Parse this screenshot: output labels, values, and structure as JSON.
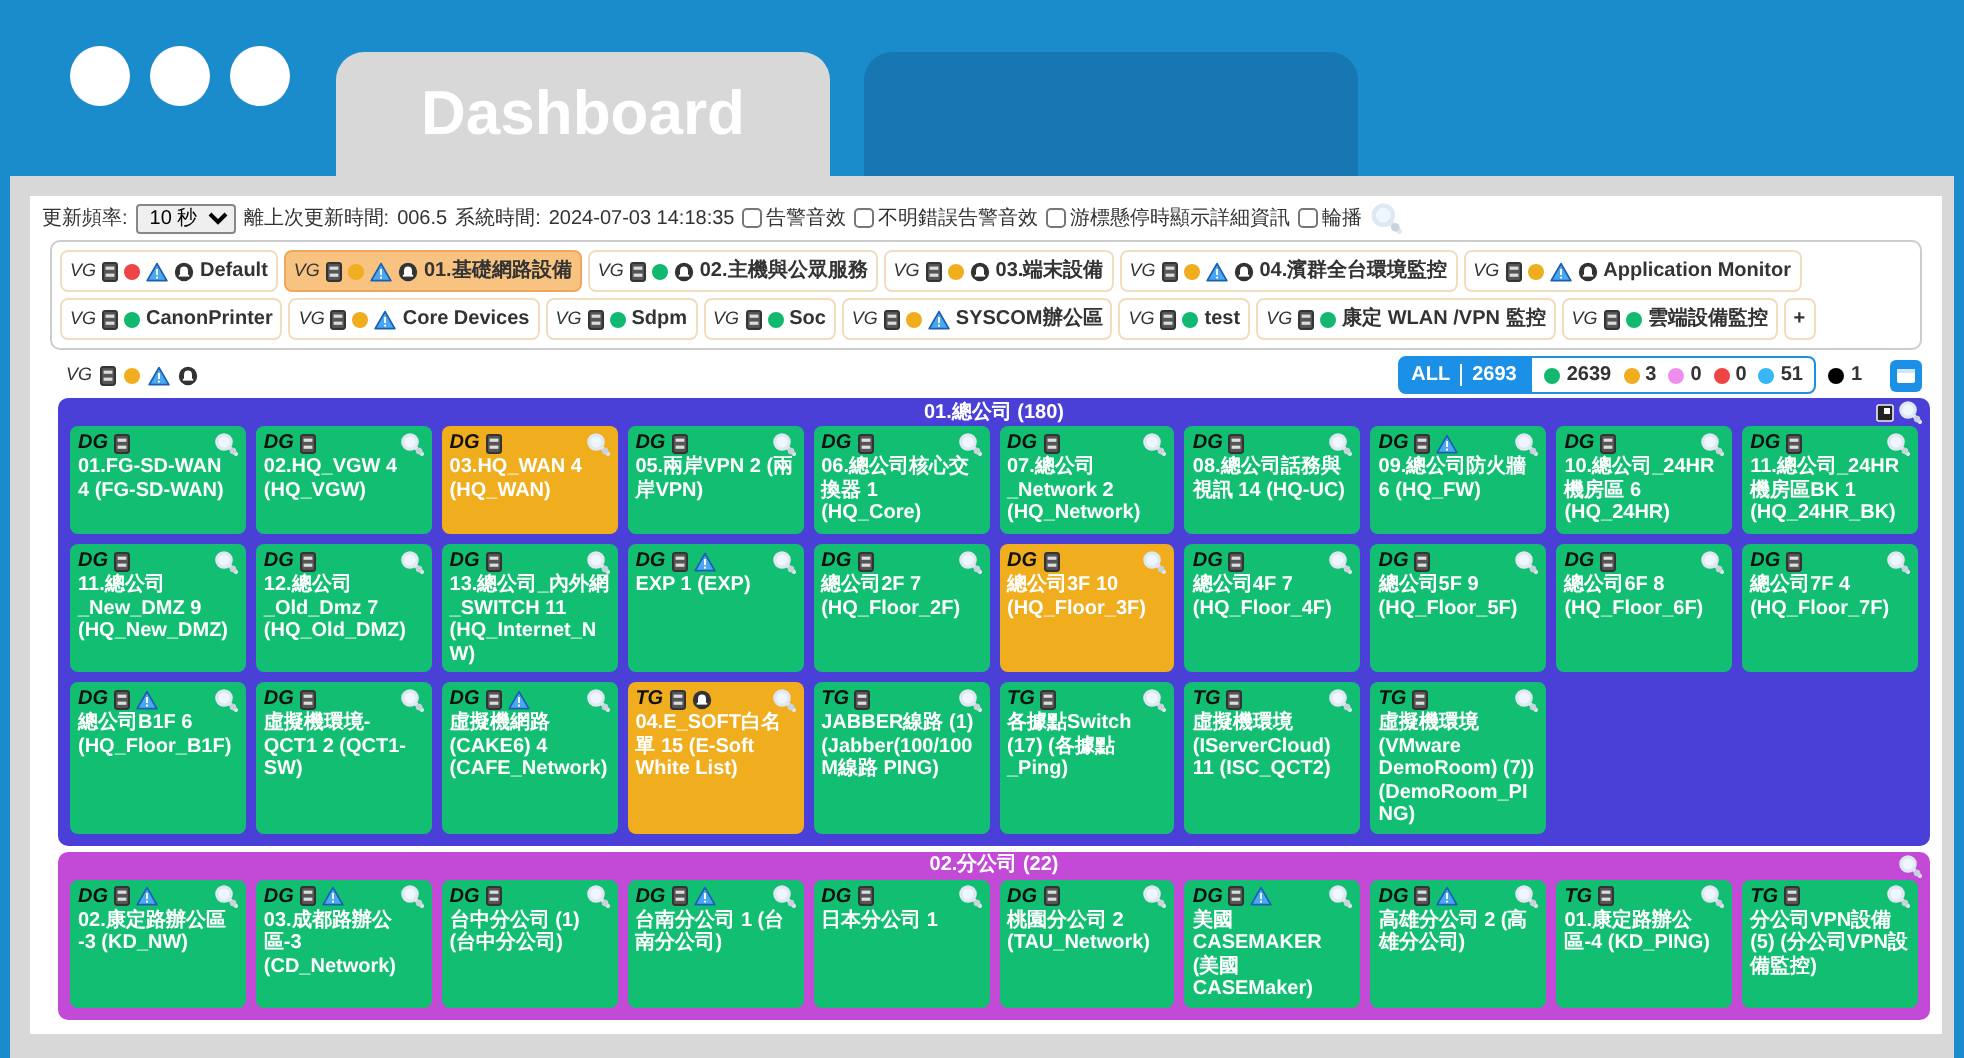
{
  "window": {
    "tabs": [
      {
        "label": "Dashboard",
        "selected": true
      },
      {
        "selected": false
      }
    ]
  },
  "toolbar": {
    "refresh_label": "更新頻率:",
    "refresh_value": "10 秒",
    "elapsed_label": "離上次更新時間:",
    "elapsed": "006.5",
    "time_label": "系統時間:",
    "time": "2024-07-03 14:18:35",
    "options": [
      {
        "label": "告警音效",
        "checked": false
      },
      {
        "label": "不明錯誤告警音效",
        "checked": false
      },
      {
        "label": "游標懸停時顯示詳細資訊",
        "checked": false
      },
      {
        "label": "輪播",
        "checked": false
      }
    ]
  },
  "view_groups": [
    {
      "tag": "VG",
      "label": "Default",
      "color": "#ef4444",
      "warning": true,
      "bell": true,
      "selected": false
    },
    {
      "tag": "VG",
      "label": "01.基礎網路設備",
      "color": "#f0ad1e",
      "warning": true,
      "bell": true,
      "selected": true
    },
    {
      "tag": "VG",
      "label": "02.主機與公眾服務",
      "color": "#10b96f",
      "warning": false,
      "bell": true,
      "selected": false
    },
    {
      "tag": "VG",
      "label": "03.端末設備",
      "color": "#f0ad1e",
      "warning": false,
      "bell": true,
      "selected": false
    },
    {
      "tag": "VG",
      "label": "04.濱群全台環境監控",
      "color": "#f0ad1e",
      "warning": true,
      "bell": true,
      "selected": false
    },
    {
      "tag": "VG",
      "label": "Application Monitor",
      "color": "#f0ad1e",
      "warning": true,
      "bell": true,
      "selected": false
    },
    {
      "tag": "VG",
      "label": "CanonPrinter",
      "color": "#10b96f",
      "warning": false,
      "bell": false,
      "selected": false
    },
    {
      "tag": "VG",
      "label": "Core Devices",
      "color": "#f0ad1e",
      "warning": true,
      "bell": false,
      "selected": false
    },
    {
      "tag": "VG",
      "label": "Sdpm",
      "color": "#10b96f",
      "warning": false,
      "bell": false,
      "selected": false
    },
    {
      "tag": "VG",
      "label": "Soc",
      "color": "#10b96f",
      "warning": false,
      "bell": false,
      "selected": false
    },
    {
      "tag": "VG",
      "label": "SYSCOM辦公區",
      "color": "#f0ad1e",
      "warning": true,
      "bell": false,
      "selected": false
    },
    {
      "tag": "VG",
      "label": "test",
      "color": "#10b96f",
      "warning": false,
      "bell": false,
      "selected": false
    },
    {
      "tag": "VG",
      "label": "康定 WLAN /VPN 監控",
      "color": "#10b96f",
      "warning": false,
      "bell": false,
      "selected": false
    },
    {
      "tag": "VG",
      "label": "雲端設備監控",
      "color": "#10b96f",
      "warning": false,
      "bell": false,
      "selected": false
    }
  ],
  "add_button": "+",
  "current": {
    "tag": "VG",
    "color": "#f0ad1e",
    "warning": true,
    "bell": true
  },
  "summary": {
    "all_label": "ALL",
    "all_count": "2693",
    "counts": [
      {
        "kind": "boxed",
        "color": "#10b96f",
        "value": "2639"
      },
      {
        "kind": "boxed",
        "color": "#f0ad1e",
        "value": "3"
      },
      {
        "kind": "boxed",
        "color": "#ee8ff0",
        "value": "0"
      },
      {
        "kind": "boxed",
        "color": "#ef4444",
        "value": "0"
      },
      {
        "kind": "boxed",
        "color": "#38b6f5",
        "value": "51"
      },
      {
        "kind": "plain",
        "color": "#000000",
        "value": "1"
      }
    ]
  },
  "groups": [
    {
      "title": "01.總公司",
      "count": "(180)",
      "color": "#4a40d8",
      "expand_icon": true,
      "devices": [
        {
          "type": "DG",
          "name": "01.FG-SD-WAN 4 (FG-SD-WAN)",
          "color": "#12bf72",
          "warning": false,
          "bell": false
        },
        {
          "type": "DG",
          "name": "02.HQ_VGW 4 (HQ_VGW)",
          "color": "#12bf72",
          "warning": false,
          "bell": false
        },
        {
          "type": "DG",
          "name": "03.HQ_WAN 4 (HQ_WAN)",
          "color": "#f0ad1e",
          "warning": false,
          "bell": false
        },
        {
          "type": "DG",
          "name": "05.兩岸VPN 2 (兩岸VPN)",
          "color": "#12bf72",
          "warning": false,
          "bell": false
        },
        {
          "type": "DG",
          "name": "06.總公司核心交換器 1 (HQ_Core)",
          "color": "#12bf72",
          "warning": false,
          "bell": false
        },
        {
          "type": "DG",
          "name": "07.總公司_Network 2 (HQ_Network)",
          "color": "#12bf72",
          "warning": false,
          "bell": false
        },
        {
          "type": "DG",
          "name": "08.總公司話務與視訊 14 (HQ-UC)",
          "color": "#12bf72",
          "warning": false,
          "bell": false
        },
        {
          "type": "DG",
          "name": "09.總公司防火牆 6 (HQ_FW)",
          "color": "#12bf72",
          "warning": true,
          "bell": false
        },
        {
          "type": "DG",
          "name": "10.總公司_24HR機房區 6 (HQ_24HR)",
          "color": "#12bf72",
          "warning": false,
          "bell": false
        },
        {
          "type": "DG",
          "name": "11.總公司_24HR機房區BK 1 (HQ_24HR_BK)",
          "color": "#12bf72",
          "warning": false,
          "bell": false
        },
        {
          "type": "DG",
          "name": "11.總公司_New_DMZ 9 (HQ_New_DMZ)",
          "color": "#12bf72",
          "warning": false,
          "bell": false
        },
        {
          "type": "DG",
          "name": "12.總公司_Old_Dmz 7 (HQ_Old_DMZ)",
          "color": "#12bf72",
          "warning": false,
          "bell": false
        },
        {
          "type": "DG",
          "name": "13.總公司_內外網_SWITCH 11 (HQ_Internet_NW)",
          "color": "#12bf72",
          "warning": false,
          "bell": false
        },
        {
          "type": "DG",
          "name": "EXP 1 (EXP)",
          "color": "#12bf72",
          "warning": true,
          "bell": false
        },
        {
          "type": "DG",
          "name": "總公司2F 7 (HQ_Floor_2F)",
          "color": "#12bf72",
          "warning": false,
          "bell": false
        },
        {
          "type": "DG",
          "name": "總公司3F 10 (HQ_Floor_3F)",
          "color": "#f0ad1e",
          "warning": false,
          "bell": false
        },
        {
          "type": "DG",
          "name": "總公司4F 7 (HQ_Floor_4F)",
          "color": "#12bf72",
          "warning": false,
          "bell": false
        },
        {
          "type": "DG",
          "name": "總公司5F 9 (HQ_Floor_5F)",
          "color": "#12bf72",
          "warning": false,
          "bell": false
        },
        {
          "type": "DG",
          "name": "總公司6F 8 (HQ_Floor_6F)",
          "color": "#12bf72",
          "warning": false,
          "bell": false
        },
        {
          "type": "DG",
          "name": "總公司7F 4 (HQ_Floor_7F)",
          "color": "#12bf72",
          "warning": false,
          "bell": false
        },
        {
          "type": "DG",
          "name": "總公司B1F 6 (HQ_Floor_B1F)",
          "color": "#12bf72",
          "warning": true,
          "bell": false
        },
        {
          "type": "DG",
          "name": "虛擬機環境-QCT1 2 (QCT1-SW)",
          "color": "#12bf72",
          "warning": false,
          "bell": false
        },
        {
          "type": "DG",
          "name": "虛擬機網路(CAKE6) 4 (CAFE_Network)",
          "color": "#12bf72",
          "warning": true,
          "bell": false
        },
        {
          "type": "TG",
          "name": "04.E_SOFT白名單 15 (E-Soft White List)",
          "color": "#f0ad1e",
          "warning": false,
          "bell": true
        },
        {
          "type": "TG",
          "name": "JABBER線路 (1) (Jabber(100/100M線路 PING)",
          "color": "#12bf72",
          "warning": false,
          "bell": false
        },
        {
          "type": "TG",
          "name": "各據點Switch (17) (各據點_Ping)",
          "color": "#12bf72",
          "warning": false,
          "bell": false
        },
        {
          "type": "TG",
          "name": "虛擬機環境(IServerCloud) 11 (ISC_QCT2)",
          "color": "#12bf72",
          "warning": false,
          "bell": false
        },
        {
          "type": "TG",
          "name": "虛擬機環境(VMware DemoRoom) (7)) (DemoRoom_PING)",
          "color": "#12bf72",
          "warning": false,
          "bell": false
        }
      ]
    },
    {
      "title": "02.分公司",
      "count": "(22)",
      "color": "#c24ad6",
      "expand_icon": false,
      "devices": [
        {
          "type": "DG",
          "name": "02.康定路辦公區 -3 (KD_NW)",
          "color": "#12bf72",
          "warning": true,
          "bell": false
        },
        {
          "type": "DG",
          "name": "03.成都路辦公區-3 (CD_Network)",
          "color": "#12bf72",
          "warning": true,
          "bell": false
        },
        {
          "type": "DG",
          "name": "台中分公司 (1) (台中分公司)",
          "color": "#12bf72",
          "warning": false,
          "bell": false
        },
        {
          "type": "DG",
          "name": "台南分公司 1 (台南分公司)",
          "color": "#12bf72",
          "warning": true,
          "bell": false
        },
        {
          "type": "DG",
          "name": "日本分公司 1",
          "color": "#12bf72",
          "warning": false,
          "bell": false
        },
        {
          "type": "DG",
          "name": "桃園分公司 2 (TAU_Network)",
          "color": "#12bf72",
          "warning": false,
          "bell": false
        },
        {
          "type": "DG",
          "name": "美國CASEMAKER (美國CASEMaker)",
          "color": "#12bf72",
          "warning": true,
          "bell": false
        },
        {
          "type": "DG",
          "name": "高雄分公司 2 (高雄分公司)",
          "color": "#12bf72",
          "warning": true,
          "bell": false
        },
        {
          "type": "TG",
          "name": "01.康定路辦公區-4 (KD_PING)",
          "color": "#12bf72",
          "warning": false,
          "bell": false
        },
        {
          "type": "TG",
          "name": "分公司VPN設備 (5) (分公司VPN設備監控)",
          "color": "#12bf72",
          "warning": false,
          "bell": false
        }
      ]
    }
  ]
}
